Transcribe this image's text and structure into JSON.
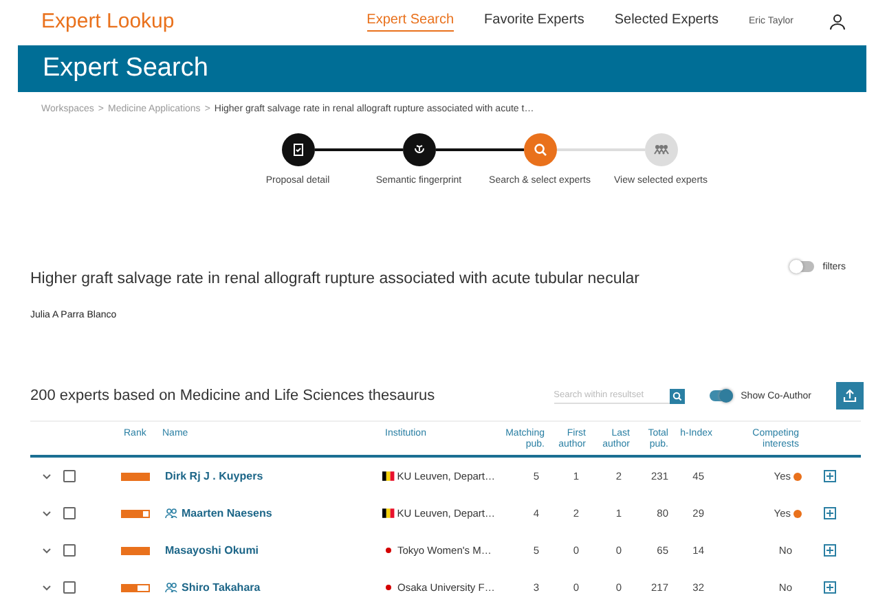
{
  "header": {
    "logo": "Expert Lookup",
    "nav": [
      {
        "label": "Expert Search",
        "selected": true
      },
      {
        "label": "Favorite Experts",
        "selected": false
      },
      {
        "label": "Selected Experts",
        "selected": false
      }
    ],
    "user": "Eric Taylor"
  },
  "banner": {
    "title": "Expert Search"
  },
  "breadcrumb": {
    "separator": ">",
    "items": [
      {
        "label": "Workspaces",
        "current": false
      },
      {
        "label": "Medicine Applications",
        "current": false
      },
      {
        "label": "Higher graft salvage rate in renal allograft rupture associated with acute t…",
        "current": true
      }
    ]
  },
  "steps": [
    {
      "label": "Proposal detail",
      "kind": "done"
    },
    {
      "label": "Semantic fingerprint",
      "kind": "done"
    },
    {
      "label": "Search & select experts",
      "kind": "current"
    },
    {
      "label": "View selected experts",
      "kind": "upcoming"
    }
  ],
  "proposal": {
    "title": "Higher graft salvage rate in renal allograft rupture associated with acute tubular necular",
    "author": "Julia A Parra Blanco",
    "filters": {
      "label": "filters",
      "on": false
    }
  },
  "results": {
    "heading": "200 experts based on Medicine and Life Sciences thesaurus",
    "search": {
      "placeholder": "Search within resultset"
    },
    "coauthor": {
      "label": "Show Co-Author",
      "on": true
    }
  },
  "table": {
    "columns": [
      "Rank",
      "Name",
      "Institution",
      "Matching pub.",
      "First author",
      "Last author",
      "Total pub.",
      "h-Index",
      "Competing interests"
    ],
    "rows": [
      {
        "checked": false,
        "level": 1,
        "coauthor": false,
        "name": "Dirk Rj J . Kuypers",
        "kind": "be",
        "institution": "KU Leuven, Depart…",
        "matching": "5",
        "first": "1",
        "last": "2",
        "total": "231",
        "h": "45",
        "competing": "Yes",
        "conflict": true
      },
      {
        "checked": false,
        "level": 0.8,
        "coauthor": true,
        "name": "Maarten Naesens",
        "kind": "be",
        "institution": "KU Leuven, Depart…",
        "matching": "4",
        "first": "2",
        "last": "1",
        "total": "80",
        "h": "29",
        "competing": "Yes",
        "conflict": true
      },
      {
        "checked": false,
        "level": 1,
        "coauthor": false,
        "name": "Masayoshi Okumi",
        "kind": "jp",
        "institution": "Tokyo Women's M…",
        "matching": "5",
        "first": "0",
        "last": "0",
        "total": "65",
        "h": "14",
        "competing": "No",
        "conflict": false
      },
      {
        "checked": false,
        "level": 0.6,
        "coauthor": true,
        "name": "Shiro Takahara",
        "kind": "jp",
        "institution": "Osaka University F…",
        "matching": "3",
        "first": "0",
        "last": "0",
        "total": "217",
        "h": "32",
        "competing": "No",
        "conflict": false
      }
    ]
  }
}
